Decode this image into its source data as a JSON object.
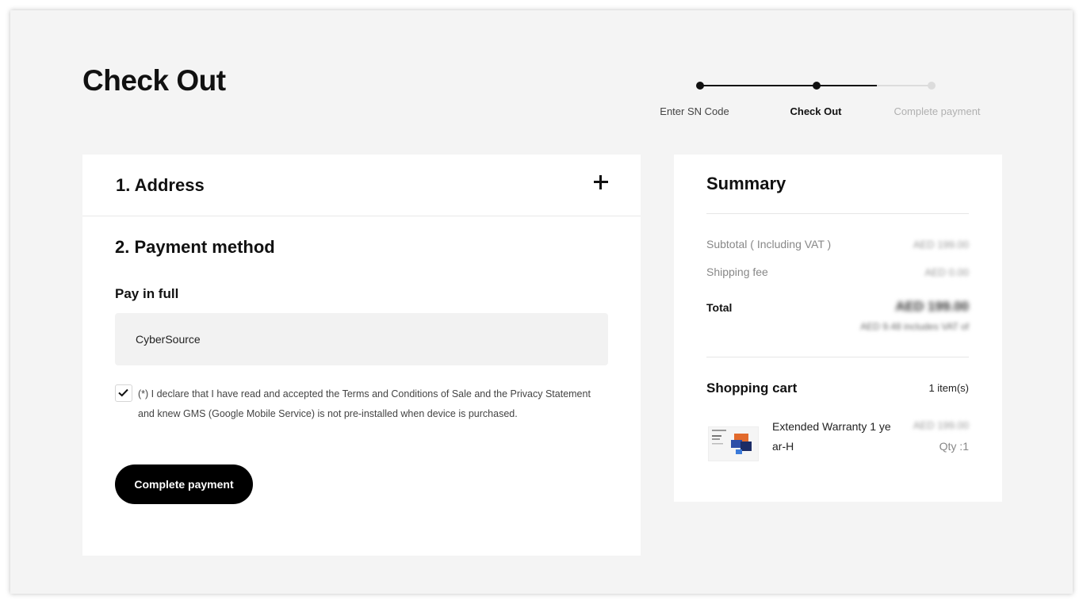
{
  "page": {
    "title": "Check Out"
  },
  "stepper": {
    "steps": [
      {
        "label": "Enter SN Code",
        "state": "done"
      },
      {
        "label": "Check Out",
        "state": "current"
      },
      {
        "label": "Complete payment",
        "state": "pending"
      }
    ],
    "colors": {
      "active": "#111111",
      "inactive": "#dcdcdc",
      "inactive_text": "#b0b0b0"
    }
  },
  "address": {
    "title": "1. Address",
    "expand_icon": "plus-icon"
  },
  "payment": {
    "title": "2. Payment method",
    "subtitle": "Pay in full",
    "method": "CyberSource",
    "consent_checked": true,
    "consent_text": "(*) I declare that I have read and accepted the Terms and Conditions of Sale and the Privacy Statement and knew GMS (Google Mobile Service) is not pre-installed when device is purchased.",
    "complete_button": "Complete payment"
  },
  "summary": {
    "title": "Summary",
    "subtotal_label": "Subtotal ( Including VAT )",
    "subtotal_value": "AED 199.00",
    "shipping_label": "Shipping fee",
    "shipping_value": "AED 0.00",
    "total_label": "Total",
    "total_value": "AED 199.00",
    "vat_note": "AED 9.48 includes VAT of"
  },
  "cart": {
    "title": "Shopping cart",
    "count": "1 item(s)",
    "items": [
      {
        "name": "Extended Warranty 1 ye ar-H",
        "price": "AED 199.00",
        "qty": "Qty :1"
      }
    ]
  }
}
